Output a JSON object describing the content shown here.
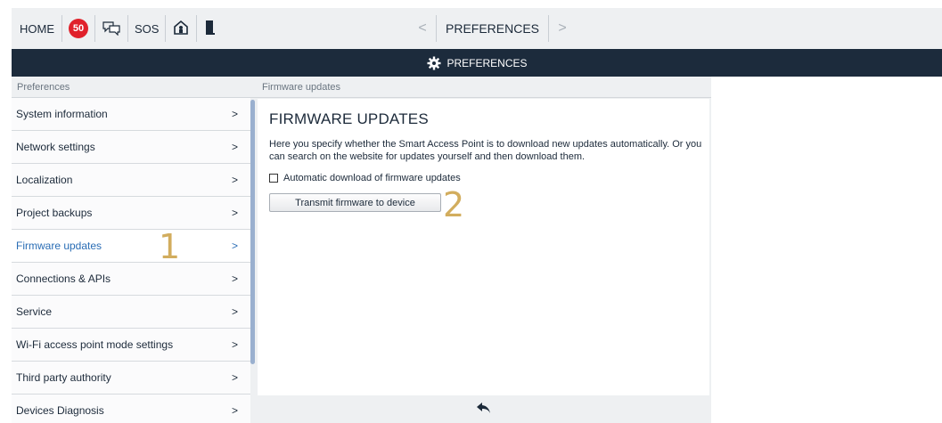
{
  "topbar": {
    "home_label": "HOME",
    "notification_count": "50",
    "sos_label": "SOS",
    "nav_title": "PREFERENCES",
    "prev_arrow": "<",
    "next_arrow": ">"
  },
  "header": {
    "title": "PREFERENCES"
  },
  "sidebar": {
    "header": "Preferences",
    "items": [
      {
        "label": "System information"
      },
      {
        "label": "Network settings"
      },
      {
        "label": "Localization"
      },
      {
        "label": "Project backups"
      },
      {
        "label": "Firmware updates",
        "active": true
      },
      {
        "label": "Connections & APIs"
      },
      {
        "label": "Service"
      },
      {
        "label": "Wi-Fi access point mode settings"
      },
      {
        "label": "Third party authority"
      },
      {
        "label": "Devices Diagnosis"
      }
    ],
    "chevron": ">"
  },
  "main": {
    "header": "Firmware updates",
    "title": "FIRMWARE UPDATES",
    "description": "Here you specify whether the Smart Access Point is to download new updates automatically. Or you can search on the website for updates yourself and then download them.",
    "checkbox_label": "Automatic download of firmware updates",
    "checkbox_checked": false,
    "transmit_button": "Transmit firmware to device"
  },
  "annotations": {
    "marker_1": "1",
    "marker_2": "2"
  },
  "colors": {
    "header_bg": "#1c2b3c",
    "accent": "#2a6db5",
    "badge": "#e0212b",
    "marker": "#d2ad5e"
  }
}
